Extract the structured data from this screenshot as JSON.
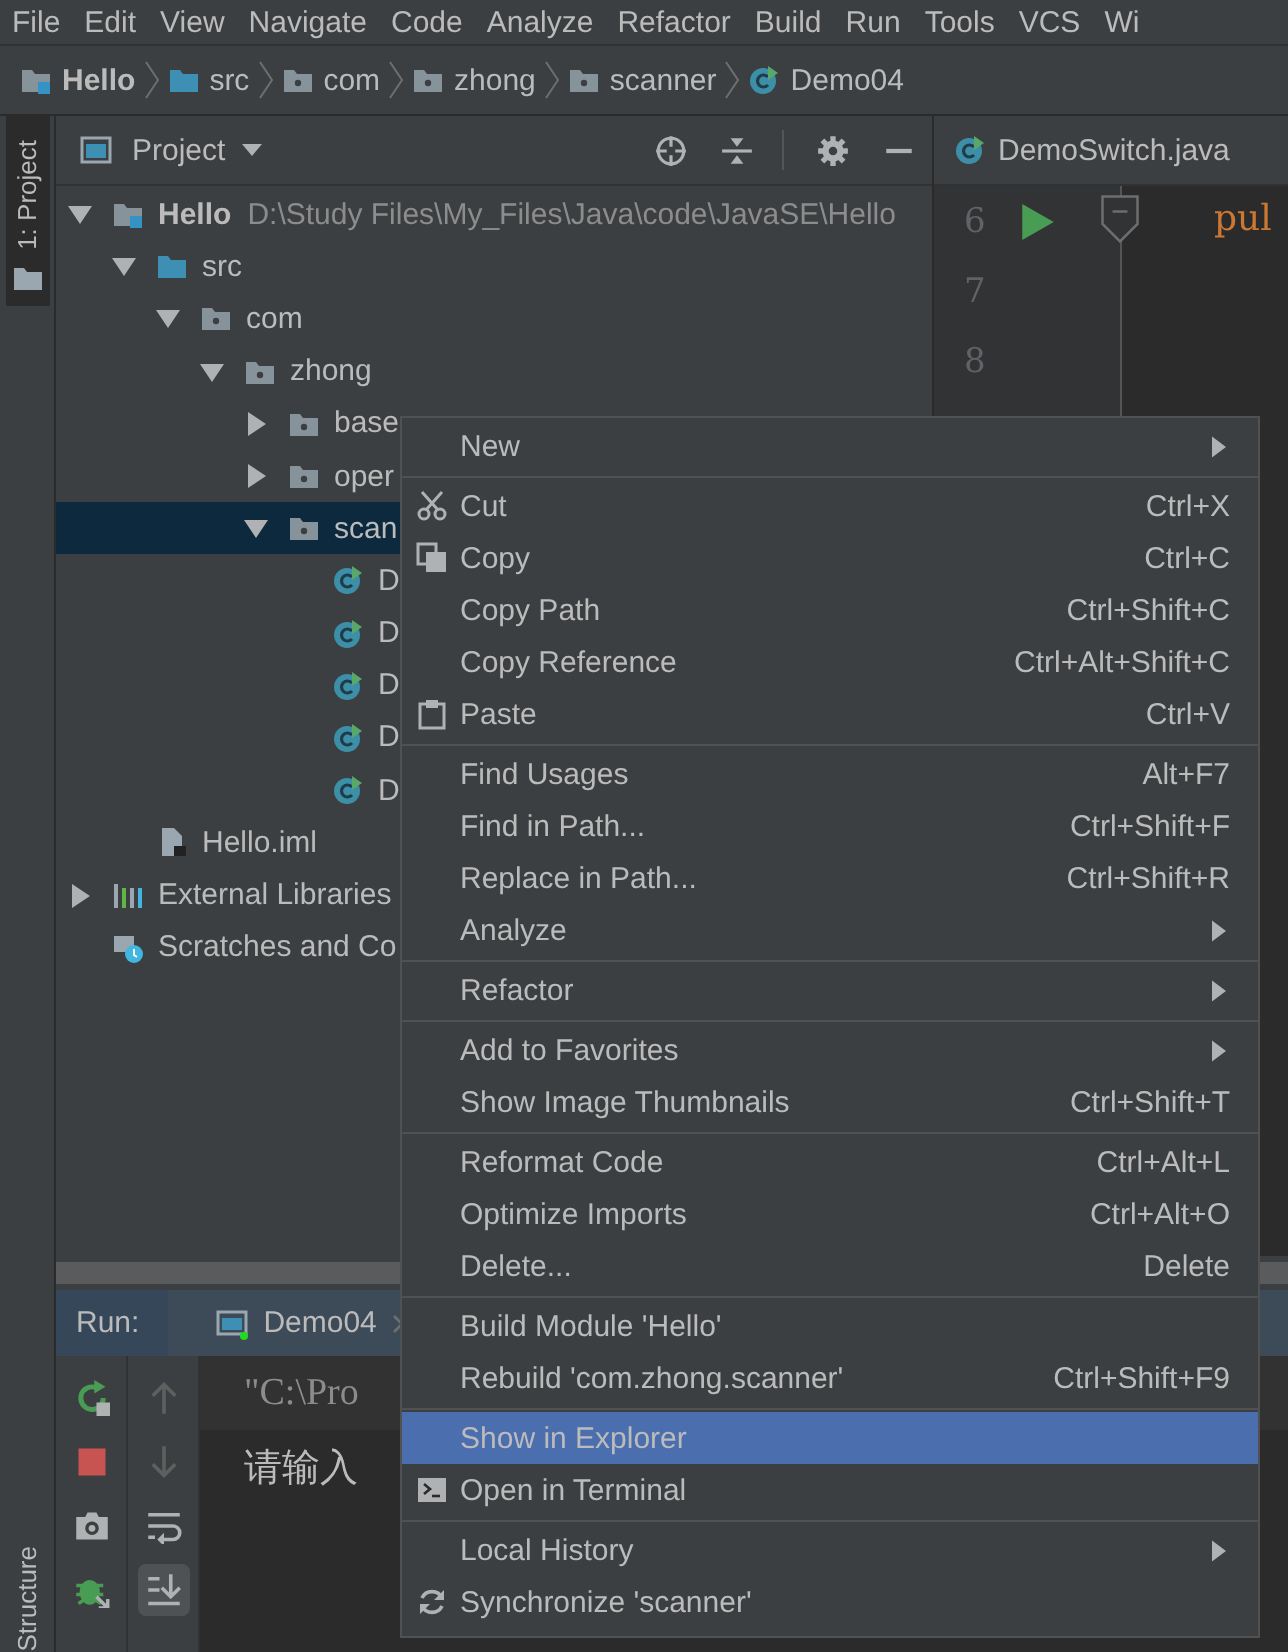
{
  "menu_bar": [
    "File",
    "Edit",
    "View",
    "Navigate",
    "Code",
    "Analyze",
    "Refactor",
    "Build",
    "Run",
    "Tools",
    "VCS",
    "Wi"
  ],
  "breadcrumb": [
    {
      "label": "Hello",
      "kind": "module"
    },
    {
      "label": "src",
      "kind": "source"
    },
    {
      "label": "com",
      "kind": "package"
    },
    {
      "label": "zhong",
      "kind": "package"
    },
    {
      "label": "scanner",
      "kind": "package"
    },
    {
      "label": "Demo04",
      "kind": "class"
    }
  ],
  "side_tabs": {
    "top": "1: Project",
    "bottom": "Structure"
  },
  "project": {
    "title": "Project",
    "tree": [
      {
        "label": "Hello",
        "path": "D:\\Study Files\\My_Files\\Java\\code\\JavaSE\\Hello",
        "kind": "module",
        "expanded": true,
        "selected": false,
        "children": [
          {
            "label": "src",
            "kind": "source",
            "expanded": true,
            "selected": false,
            "children": [
              {
                "label": "com",
                "kind": "package",
                "expanded": true,
                "selected": false,
                "children": [
                  {
                    "label": "zhong",
                    "kind": "package",
                    "expanded": true,
                    "selected": false,
                    "children": [
                      {
                        "label": "base",
                        "kind": "package",
                        "expanded": false,
                        "selected": false
                      },
                      {
                        "label": "oper",
                        "kind": "package",
                        "expanded": false,
                        "selected": false
                      },
                      {
                        "label": "scan",
                        "kind": "package",
                        "expanded": true,
                        "selected": true,
                        "children": [
                          {
                            "label": "D",
                            "kind": "class",
                            "selected": false
                          },
                          {
                            "label": "D",
                            "kind": "class",
                            "selected": false
                          },
                          {
                            "label": "D",
                            "kind": "class",
                            "selected": false
                          },
                          {
                            "label": "D",
                            "kind": "class",
                            "selected": false
                          },
                          {
                            "label": "D",
                            "kind": "class",
                            "selected": false
                          }
                        ]
                      }
                    ]
                  }
                ]
              }
            ]
          },
          {
            "label": "Hello.iml",
            "kind": "iml",
            "selected": false
          }
        ]
      },
      {
        "label": "External Libraries",
        "kind": "libraries",
        "expanded": false,
        "selected": false
      },
      {
        "label": "Scratches and Co",
        "kind": "scratches",
        "selected": false
      }
    ]
  },
  "editor": {
    "tab": "DemoSwitch.java",
    "line_numbers": [
      "6",
      "7",
      "8"
    ],
    "code": "pul"
  },
  "run": {
    "label": "Run:",
    "tab": "Demo04",
    "scroll_to_end": true,
    "console": [
      "\"C:\\Pro",
      "请输入"
    ]
  },
  "context_menu": [
    [
      {
        "label": "New",
        "submenu": true,
        "selected": false
      }
    ],
    [
      {
        "label": "Cut",
        "shortcut": "Ctrl+X",
        "kind": "cut",
        "submenu": false,
        "selected": false
      },
      {
        "label": "Copy",
        "shortcut": "Ctrl+C",
        "kind": "copy",
        "submenu": false,
        "selected": false
      },
      {
        "label": "Copy Path",
        "shortcut": "Ctrl+Shift+C",
        "submenu": false,
        "selected": false
      },
      {
        "label": "Copy Reference",
        "shortcut": "Ctrl+Alt+Shift+C",
        "submenu": false,
        "selected": false
      },
      {
        "label": "Paste",
        "shortcut": "Ctrl+V",
        "kind": "paste",
        "submenu": false,
        "selected": false
      }
    ],
    [
      {
        "label": "Find Usages",
        "shortcut": "Alt+F7",
        "submenu": false,
        "selected": false
      },
      {
        "label": "Find in Path...",
        "shortcut": "Ctrl+Shift+F",
        "submenu": false,
        "selected": false
      },
      {
        "label": "Replace in Path...",
        "shortcut": "Ctrl+Shift+R",
        "submenu": false,
        "selected": false
      },
      {
        "label": "Analyze",
        "submenu": true,
        "selected": false
      }
    ],
    [
      {
        "label": "Refactor",
        "submenu": true,
        "selected": false
      }
    ],
    [
      {
        "label": "Add to Favorites",
        "submenu": true,
        "selected": false
      },
      {
        "label": "Show Image Thumbnails",
        "shortcut": "Ctrl+Shift+T",
        "submenu": false,
        "selected": false
      }
    ],
    [
      {
        "label": "Reformat Code",
        "shortcut": "Ctrl+Alt+L",
        "submenu": false,
        "selected": false
      },
      {
        "label": "Optimize Imports",
        "shortcut": "Ctrl+Alt+O",
        "submenu": false,
        "selected": false
      },
      {
        "label": "Delete...",
        "shortcut": "Delete",
        "submenu": false,
        "selected": false
      }
    ],
    [
      {
        "label": "Build Module 'Hello'",
        "submenu": false,
        "selected": false
      },
      {
        "label": "Rebuild 'com.zhong.scanner'",
        "shortcut": "Ctrl+Shift+F9",
        "submenu": false,
        "selected": false
      }
    ],
    [
      {
        "label": "Show in Explorer",
        "submenu": false,
        "selected": true
      },
      {
        "label": "Open in Terminal",
        "kind": "terminal",
        "submenu": false,
        "selected": false
      }
    ],
    [
      {
        "label": "Local History",
        "submenu": true,
        "selected": false
      },
      {
        "label": "Synchronize 'scanner'",
        "kind": "sync",
        "submenu": false,
        "selected": false
      }
    ]
  ]
}
